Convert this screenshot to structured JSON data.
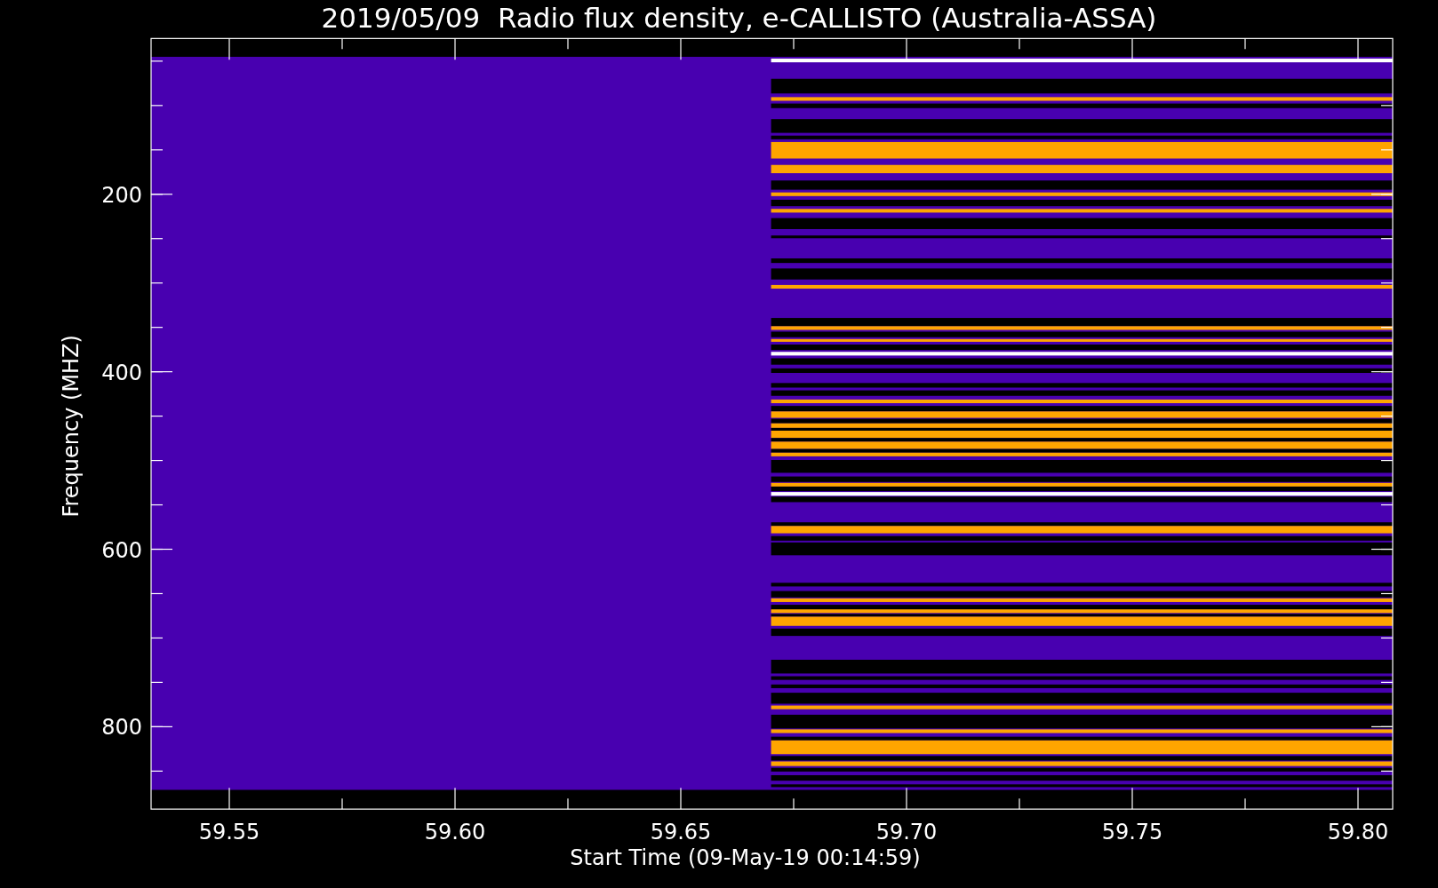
{
  "title": "2019/05/09  Radio flux density, e-CALLISTO (Australia-ASSA)",
  "y_axis": {
    "label": "Frequency (MHZ)",
    "ticks": [
      "200",
      "400",
      "600",
      "800"
    ]
  },
  "x_axis": {
    "label": "Start Time (09-May-19 00:14:59)",
    "ticks": [
      "59.55",
      "59.60",
      "59.65",
      "59.70",
      "59.75",
      "59.80"
    ]
  }
}
